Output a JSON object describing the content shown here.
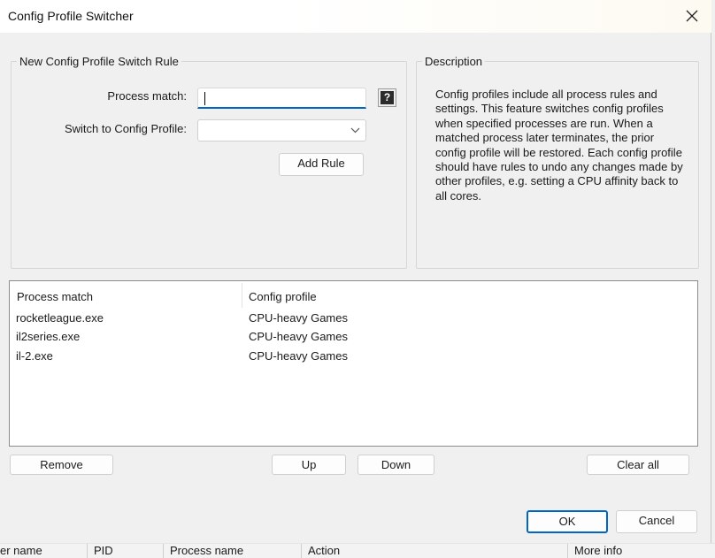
{
  "window": {
    "title": "Config Profile Switcher"
  },
  "new_rule": {
    "legend": "New Config Profile Switch Rule",
    "process_match_label": "Process match:",
    "process_match_value": "",
    "help_glyph": "?",
    "switch_to_label": "Switch to Config Profile:",
    "switch_to_value": "",
    "add_rule_label": "Add Rule"
  },
  "description": {
    "legend": "Description",
    "text": "Config profiles include all process rules and settings. This feature switches config profiles when specified processes are run. When a matched process later terminates, the prior config profile will be restored. Each config profile should have rules to undo any changes made by other profiles, e.g. setting a CPU affinity back to all cores."
  },
  "rules_table": {
    "columns": [
      "Process match",
      "Config profile"
    ],
    "rows": [
      {
        "process": "rocketleague.exe",
        "profile": "CPU-heavy Games"
      },
      {
        "process": "il2series.exe",
        "profile": "CPU-heavy Games"
      },
      {
        "process": "il-2.exe",
        "profile": "CPU-heavy Games"
      }
    ]
  },
  "buttons": {
    "remove": "Remove",
    "up": "Up",
    "down": "Down",
    "clear_all": "Clear all",
    "ok": "OK",
    "cancel": "Cancel"
  },
  "background_header": {
    "columns": [
      "er name",
      "PID",
      "Process name",
      "Action",
      "More info"
    ]
  },
  "icons": {
    "close": "close-icon",
    "help": "help-icon",
    "dropdown": "chevron-down-icon"
  },
  "colors": {
    "accent": "#0067c0",
    "window_bg": "#f0f0f0"
  }
}
